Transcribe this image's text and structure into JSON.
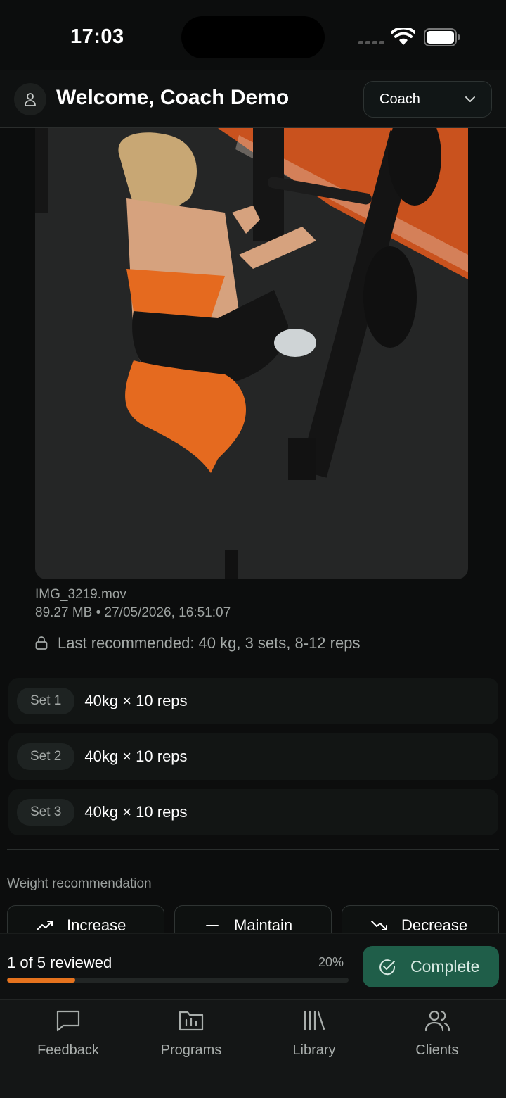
{
  "status_bar": {
    "time": "17:03"
  },
  "header": {
    "welcome": "Welcome, Coach Demo",
    "role": "Coach"
  },
  "video": {
    "file_name": "IMG_3219.mov",
    "meta": "89.27 MB • 27/05/2026, 16:51:07"
  },
  "last_recommended": "Last recommended: 40 kg, 3 sets, 8-12 reps",
  "sets": [
    {
      "label": "Set 1",
      "value": "40kg × 10 reps"
    },
    {
      "label": "Set 2",
      "value": "40kg × 10 reps"
    },
    {
      "label": "Set 3",
      "value": "40kg × 10 reps"
    }
  ],
  "weight_recommendation": {
    "label": "Weight recommendation",
    "options": [
      "Increase",
      "Maintain",
      "Decrease"
    ]
  },
  "progress": {
    "text": "1 of 5 reviewed",
    "percent_label": "20%",
    "fraction": 0.2,
    "complete_label": "Complete"
  },
  "tabs": [
    {
      "label": "Feedback",
      "icon": "message-square-icon"
    },
    {
      "label": "Programs",
      "icon": "folder-chart-icon"
    },
    {
      "label": "Library",
      "icon": "library-icon"
    },
    {
      "label": "Clients",
      "icon": "users-icon"
    }
  ],
  "colors": {
    "accent": "#e5731e",
    "complete_bg": "#1f5e49",
    "background": "#0c0d0d"
  }
}
